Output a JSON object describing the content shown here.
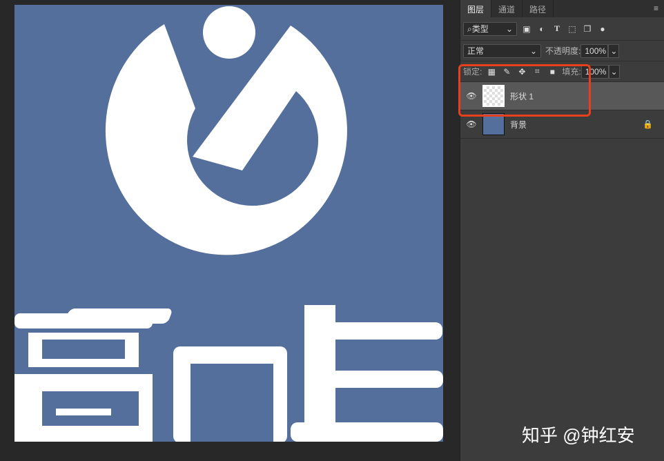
{
  "canvas": {
    "bg_color": "#546f9b",
    "logo_text": "高分生"
  },
  "panel": {
    "tabs": [
      "图层",
      "通道",
      "路径"
    ],
    "filter": {
      "label": "类型",
      "icons": [
        "image-filter-icon",
        "adjustment-filter-icon",
        "type-filter-icon",
        "shape-filter-icon",
        "smart-object-filter-icon"
      ]
    },
    "blend_mode": "正常",
    "opacity_label": "不透明度:",
    "opacity_value": "100%",
    "lock_label": "锁定:",
    "fill_label": "填充:",
    "fill_value": "100%",
    "layers": [
      {
        "name": "形状 1",
        "selected": true
      },
      {
        "name": "背景",
        "locked": true
      }
    ]
  },
  "watermark": "知乎 @钟红安",
  "highlight_color": "#e8401c"
}
